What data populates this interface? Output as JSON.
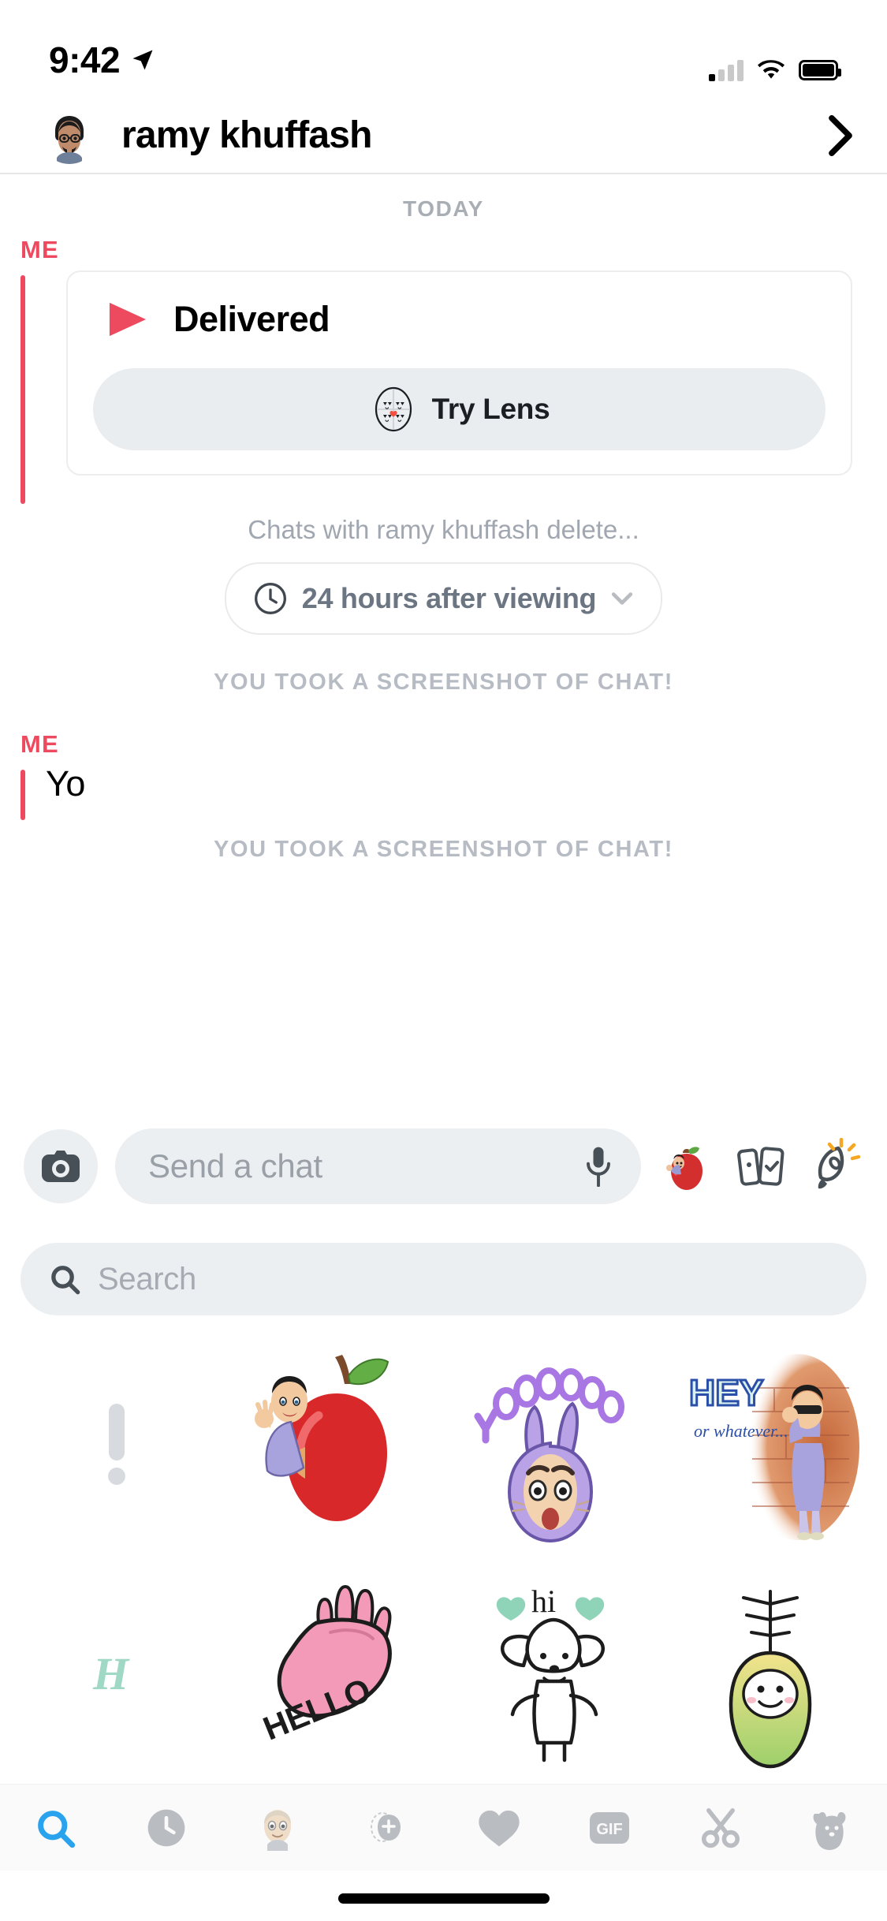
{
  "status_bar": {
    "time": "9:42",
    "location_icon": "location-arrow-icon",
    "signal_icon": "cellular-signal-icon",
    "wifi_icon": "wifi-icon",
    "battery_icon": "battery-full-icon"
  },
  "header": {
    "avatar_icon": "bitmoji-avatar",
    "name": "ramy khuffash",
    "chevron_icon": "chevron-right-icon"
  },
  "conversation": {
    "day_divider": "TODAY",
    "snap": {
      "sender": "ME",
      "status": "Delivered",
      "arrow_icon": "snap-sent-arrow-icon",
      "try_lens_label": "Try Lens",
      "lens_icon": "lens-faces-heart-icon"
    },
    "delete_note": "Chats with ramy khuffash delete...",
    "timer": {
      "clock_icon": "clock-icon",
      "label": "24 hours after viewing",
      "chevron_icon": "chevron-down-icon"
    },
    "screenshot_note_1": "YOU TOOK A SCREENSHOT OF CHAT!",
    "text_message": {
      "sender": "ME",
      "text": "Yo"
    },
    "screenshot_note_2": "YOU TOOK A SCREENSHOT OF CHAT!"
  },
  "input_bar": {
    "camera_icon": "camera-icon",
    "placeholder": "Send a chat",
    "mic_icon": "microphone-icon",
    "sticker_icon": "bitmoji-apple-sticker-icon",
    "cards_icon": "cameo-cards-icon",
    "rocket_icon": "rocket-icon"
  },
  "search": {
    "icon": "search-icon",
    "placeholder": "Search"
  },
  "sticker_grid": {
    "items": [
      {
        "name": "exclamation-sticker",
        "label": "!"
      },
      {
        "name": "apple-bitmoji-sticker",
        "label": ""
      },
      {
        "name": "yoooooooooo-bunny-sticker",
        "label": "YOOOOOOOOO"
      },
      {
        "name": "hey-or-whatever-sticker",
        "label": "HEY",
        "sublabel": "or whatever..."
      },
      {
        "name": "letter-h-sticker",
        "label": "H"
      },
      {
        "name": "hello-hand-sticker",
        "label": "HELLO"
      },
      {
        "name": "hi-dog-sticker",
        "label": "hi"
      },
      {
        "name": "sprout-creature-sticker",
        "label": ""
      }
    ]
  },
  "tab_bar": {
    "items": [
      {
        "name": "tab-search",
        "icon": "search-icon",
        "active": true
      },
      {
        "name": "tab-recent",
        "icon": "clock-icon",
        "active": false
      },
      {
        "name": "tab-bitmoji",
        "icon": "bitmoji-face-icon",
        "active": false
      },
      {
        "name": "tab-friendmoji",
        "icon": "bitmoji-add-friend-icon",
        "active": false
      },
      {
        "name": "tab-favorites",
        "icon": "heart-icon",
        "active": false
      },
      {
        "name": "tab-gif",
        "icon": "gif-icon",
        "label": "GIF",
        "active": false
      },
      {
        "name": "tab-scissors",
        "icon": "scissors-icon",
        "active": false
      },
      {
        "name": "tab-cutouts",
        "icon": "bear-cutout-icon",
        "active": false
      }
    ],
    "active_color": "#2aa3ef",
    "inactive_color": "#b9bcc1"
  },
  "colors": {
    "accent_red": "#ed4a5f",
    "chip_gray": "#eceff1",
    "muted_text": "#a9aeb5"
  }
}
